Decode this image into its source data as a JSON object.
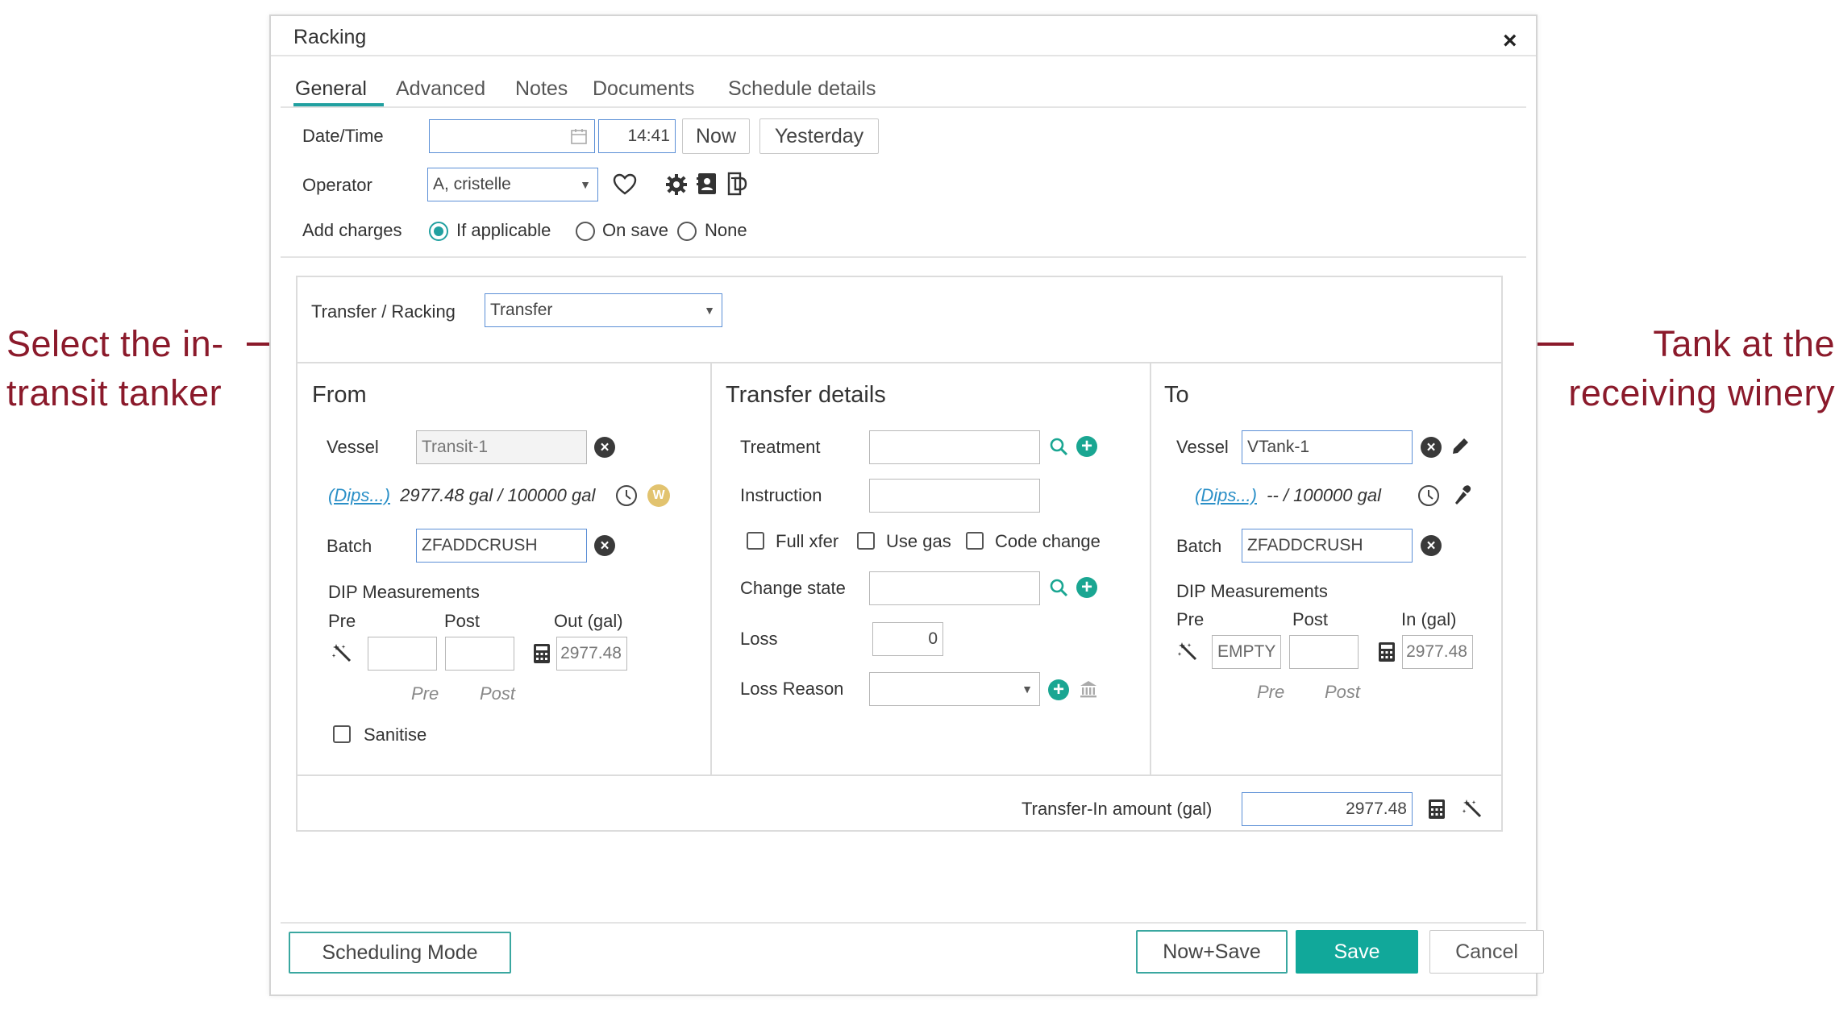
{
  "callouts": {
    "left": [
      "Select the in-",
      "transit tanker"
    ],
    "right": [
      "Tank at the",
      "receiving winery"
    ]
  },
  "dialog": {
    "title": "Racking",
    "close_glyph": "×",
    "tabs": [
      "General",
      "Advanced",
      "Notes",
      "Documents",
      "Schedule details"
    ],
    "active_tab": "General"
  },
  "general": {
    "datetime_label": "Date/Time",
    "date_value": "",
    "time_value": "14:41",
    "now_label": "Now",
    "yesterday_label": "Yesterday",
    "operator_label": "Operator",
    "operator_value": "A, cristelle",
    "add_charges_label": "Add charges",
    "charges_options": [
      "If applicable",
      "On save",
      "None"
    ],
    "charges_selected": "If applicable"
  },
  "transfer": {
    "type_label": "Transfer / Racking",
    "type_value": "Transfer"
  },
  "from": {
    "title": "From",
    "vessel_label": "Vessel",
    "vessel_value": "Transit-1",
    "dips_link": "(Dips...)",
    "dips_value": "2977.48 gal / 100000 gal",
    "w_badge": "W",
    "batch_label": "Batch",
    "batch_value": "ZFADDCRUSH",
    "dip_title": "DIP Measurements",
    "pre_header": "Pre",
    "post_header": "Post",
    "out_header": "Out (gal)",
    "pre_value": "",
    "post_value": "",
    "out_value": "2977.48",
    "pre_caption": "Pre",
    "post_caption": "Post",
    "sanitise_label": "Sanitise"
  },
  "details": {
    "title": "Transfer details",
    "treatment_label": "Treatment",
    "treatment_value": "",
    "instruction_label": "Instruction",
    "instruction_value": "",
    "full_xfer_label": "Full xfer",
    "use_gas_label": "Use gas",
    "code_change_label": "Code change",
    "change_state_label": "Change state",
    "change_state_value": "",
    "loss_label": "Loss",
    "loss_value": "0",
    "loss_reason_label": "Loss Reason",
    "loss_reason_value": ""
  },
  "to": {
    "title": "To",
    "vessel_label": "Vessel",
    "vessel_value": "VTank-1",
    "dips_link": "(Dips...)",
    "dips_value": "-- / 100000 gal",
    "batch_label": "Batch",
    "batch_value": "ZFADDCRUSH",
    "dip_title": "DIP Measurements",
    "pre_header": "Pre",
    "post_header": "Post",
    "in_header": "In (gal)",
    "pre_value": "EMPTY",
    "post_value": "",
    "in_value": "2977.48",
    "pre_caption": "Pre",
    "post_caption": "Post"
  },
  "amount": {
    "label": "Transfer-In amount (gal)",
    "value": "2977.48"
  },
  "footer": {
    "scheduling_mode": "Scheduling Mode",
    "now_save": "Now+Save",
    "save": "Save",
    "cancel": "Cancel"
  },
  "colors": {
    "accent": "#21a0a0",
    "save_button": "#11a89a",
    "callout": "#8b1a2b",
    "link": "#2a8fc7",
    "add_green": "#1aa692"
  }
}
